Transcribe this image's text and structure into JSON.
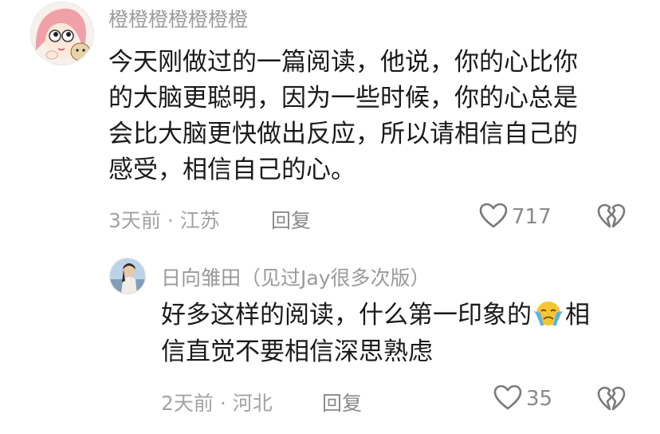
{
  "comments": [
    {
      "username": "橙橙橙橙橙橙橙",
      "body_lines": [
        "今天刚做过的一篇阅读，他说，你的心比你",
        "的大脑更聪明，因为一些时候，你的心总是",
        "会比大脑更快做出反应，所以请相信自己的",
        "感受，相信自己的心。"
      ],
      "meta": "3天前 · 江苏",
      "reply_label": "回复",
      "like_count": "717"
    },
    {
      "username": "日向雏田（见过Jay很多次版）",
      "body_line1_before_emoji": "好多这样的阅读，什么第一印象的",
      "emoji": "crying-face-emoji",
      "body_line1_after_emoji": "相",
      "body_line2": "信直觉不要相信深思熟虑",
      "meta": "2天前 · 河北",
      "reply_label": "回复",
      "like_count": "35"
    }
  ],
  "icons": {
    "like": "heart-outline-icon",
    "dislike": "broken-heart-icon"
  },
  "colors": {
    "text_primary": "#1a1a1a",
    "text_secondary": "#9a9a9a",
    "icon": "#7a7a7a",
    "emoji_yellow": "#f7c531",
    "tear_blue": "#4fb4f0"
  }
}
